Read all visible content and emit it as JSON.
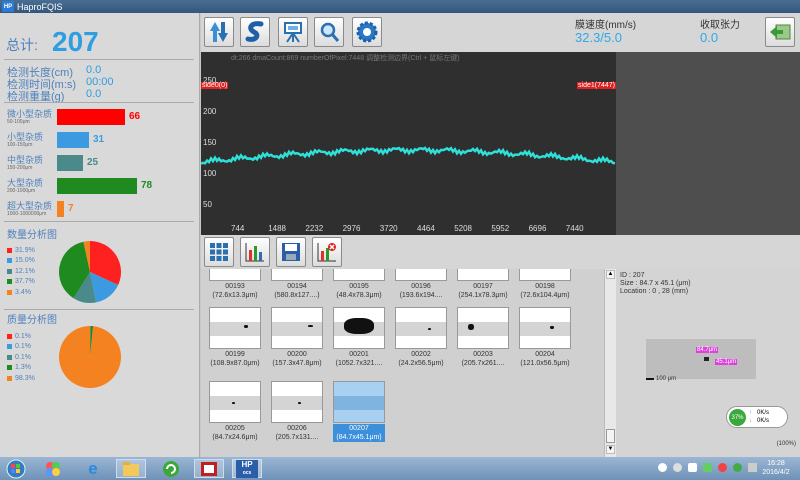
{
  "window": {
    "title": "HaproFQIS",
    "logo": "HP"
  },
  "summary": {
    "total_label": "总计:",
    "total_value": "207",
    "stats": [
      {
        "label": "检测长度(cm)",
        "value": "0.0"
      },
      {
        "label": "检测时间(m:s)",
        "value": "00:00"
      },
      {
        "label": "检测重量(g)",
        "value": "0.0"
      }
    ]
  },
  "categories": [
    {
      "label": "微小型杂质",
      "range": "50-100μm",
      "count": "66",
      "color": "#ff0000",
      "fill": 0.85
    },
    {
      "label": "小型杂质",
      "range": "100-150μm",
      "count": "31",
      "color": "#3c9be0",
      "fill": 0.4
    },
    {
      "label": "中型杂质",
      "range": "150-200μm",
      "count": "25",
      "color": "#4a8a8a",
      "fill": 0.32
    },
    {
      "label": "大型杂质",
      "range": "200-1000μm",
      "count": "78",
      "color": "#1f8a1f",
      "fill": 1.0
    },
    {
      "label": "超大型杂质",
      "range": "1000-1000000μm",
      "count": "7",
      "color": "#f58220",
      "fill": 0.09
    }
  ],
  "count_chart": {
    "title": "数量分析图",
    "legend": [
      "31.9%",
      "15.0%",
      "12.1%",
      "37.7%",
      "3.4%"
    ]
  },
  "mass_chart": {
    "title": "质量分析图",
    "legend": [
      "0.1%",
      "0.1%",
      "0.1%",
      "1.3%",
      "98.3%"
    ]
  },
  "pie_colors": [
    "#ff2020",
    "#3c9be0",
    "#4a8a8a",
    "#1f8a1f",
    "#f58220"
  ],
  "toolbar": {
    "icons": [
      "upload-download-icon",
      "s-logo-icon",
      "projector-icon",
      "magnifier-icon",
      "settings-icon"
    ],
    "speed_label": "膜速度(mm/s)",
    "speed_value": "32.3/5.0",
    "tension_label": "收取张力",
    "tension_value": "0.0",
    "export_icon": "export-icon"
  },
  "graph": {
    "header": "dt:266  dmaCount:869  numberOfPixel:7448  调整检测边界(Ctrl + 鼠标左键)",
    "side_left": "side0(0)",
    "side_right": "side1(7447)",
    "yticks": [
      "250",
      "200",
      "150",
      "100",
      "50"
    ],
    "xticks": [
      "744",
      "1488",
      "2232",
      "2976",
      "3720",
      "4464",
      "5208",
      "5952",
      "6696",
      "7440"
    ]
  },
  "bottom_tools": [
    "grid-icon",
    "bar-chart-icon",
    "save-icon",
    "clear-chart-icon"
  ],
  "thumbnails": [
    {
      "id": "00193",
      "size": "(72.6x13.3μm)"
    },
    {
      "id": "00194",
      "size": "(580.8x127....)"
    },
    {
      "id": "00195",
      "size": "(48.4x78.3μm)"
    },
    {
      "id": "00196",
      "size": "(193.6x194...."
    },
    {
      "id": "00197",
      "size": "(254.1x78.3μm)"
    },
    {
      "id": "00198",
      "size": "(72.6x104.4μm)"
    },
    {
      "id": "00199",
      "size": "(108.9x87.0μm)"
    },
    {
      "id": "00200",
      "size": "(157.3x47.8μm)"
    },
    {
      "id": "00201",
      "size": "(1052.7x321...."
    },
    {
      "id": "00202",
      "size": "(24.2x56.5μm)"
    },
    {
      "id": "00203",
      "size": "(205.7x261...."
    },
    {
      "id": "00204",
      "size": "(121.0x56.5μm)"
    },
    {
      "id": "00205",
      "size": "(84.7x24.6μm)"
    },
    {
      "id": "00206",
      "size": "(205.7x131...."
    },
    {
      "id": "00207",
      "size": "(84.7x45.1μm)"
    }
  ],
  "detail": {
    "id": "ID : 207",
    "size": "Size : 84.7 x 45.1 (μm)",
    "location": "Location : 0 , 28 (mm)",
    "tag1": "84.7μm",
    "tag2": "45.1μm",
    "scale": "100 μm",
    "gauge": "37%",
    "rate1": "0K/s",
    "rate2": "0K/s",
    "zoom": "(100%)"
  },
  "taskbar": {
    "apps": [
      "start-orb-icon",
      "windows-explorer-icon",
      "internet-explorer-icon",
      "folder-icon",
      "refresh-app-icon",
      "media-app-icon",
      "hp-app-icon"
    ],
    "hp_label1": "HP",
    "hp_label2": "ocs",
    "time": "16:28",
    "date": "2016/4/2"
  }
}
